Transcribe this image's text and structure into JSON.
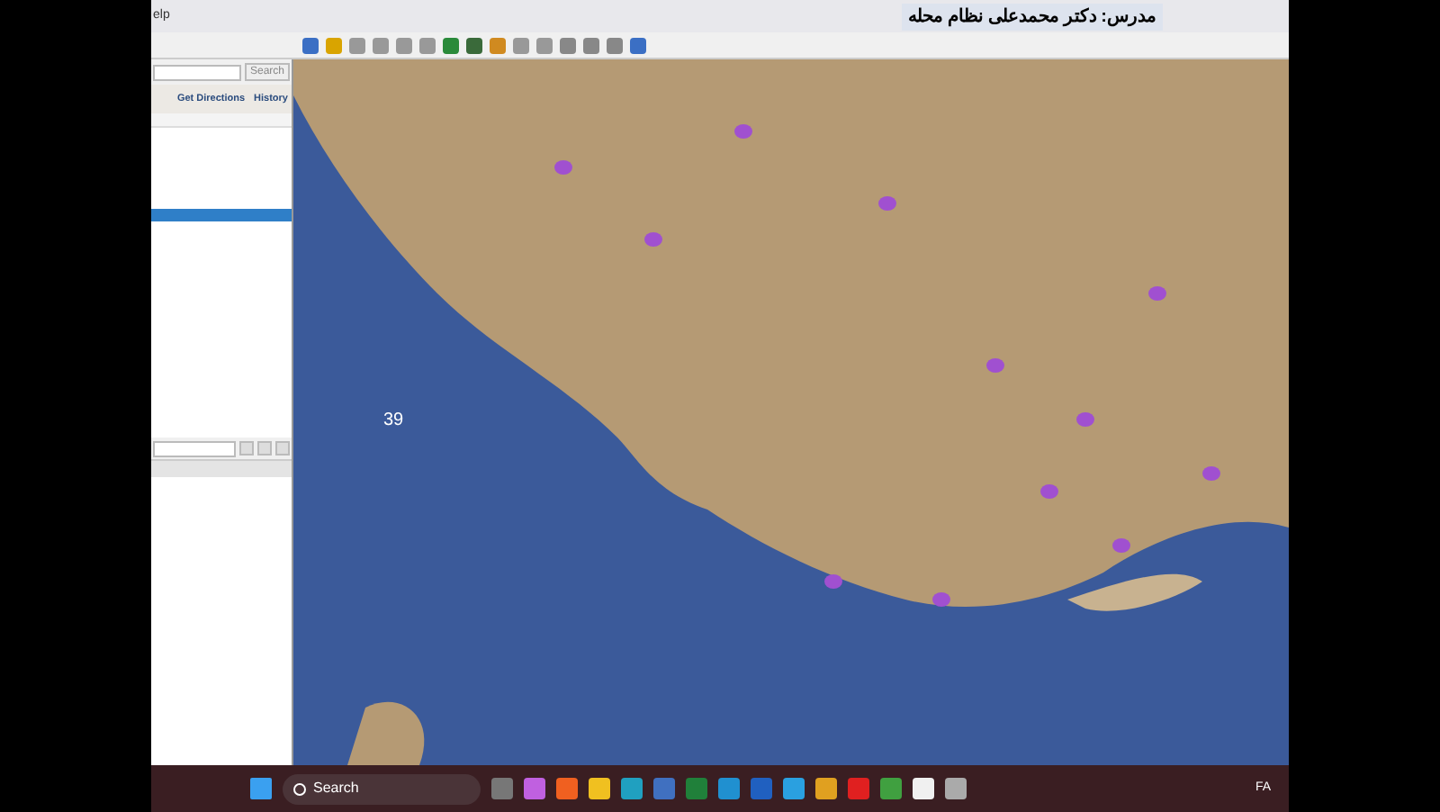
{
  "menu_bar": {
    "item": "elp"
  },
  "title": "مدرس: دکتر محمدعلی نظام محله",
  "sidebar": {
    "search_button": "Search",
    "links": [
      "Get Directions",
      "History"
    ],
    "selected_row": true
  },
  "map": {
    "label": "39"
  },
  "taskbar": {
    "search": "Search",
    "tray": [
      "FA"
    ]
  }
}
